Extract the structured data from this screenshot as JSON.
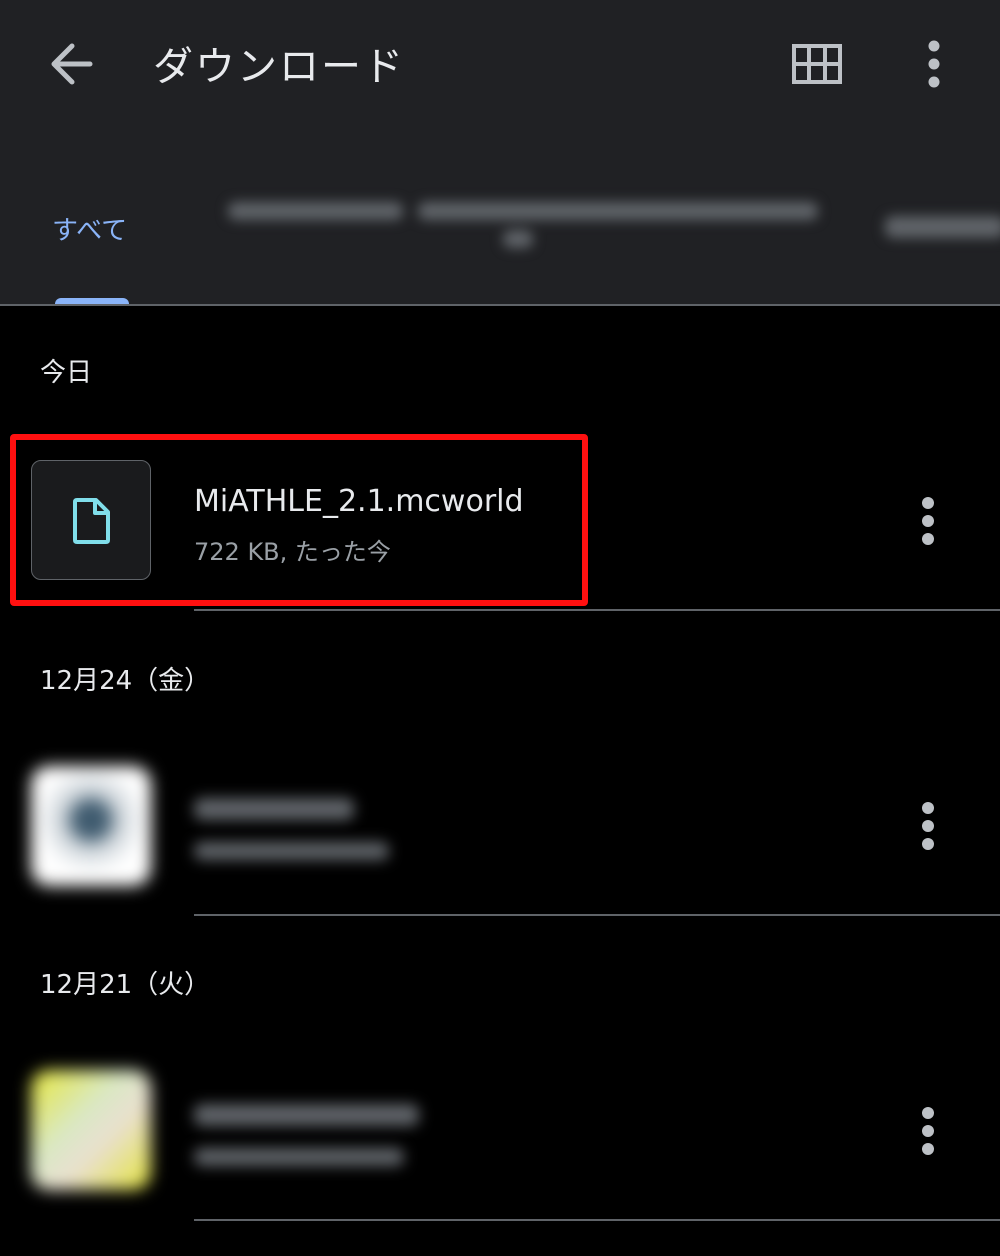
{
  "header": {
    "title": "ダウンロード",
    "back_icon": "arrow-back-icon",
    "grid_icon": "grid-view-icon",
    "more_icon": "more-vert-icon"
  },
  "tabs": {
    "active_label": "すべて",
    "accent_color": "#8ab4f8"
  },
  "sections": [
    {
      "label": "今日"
    },
    {
      "label": "12月24（金）"
    },
    {
      "label": "12月21（火）"
    }
  ],
  "items": [
    {
      "name": "MiATHLE_2.1.mcworld",
      "meta": "722 KB, たった今",
      "icon": "file-icon",
      "highlighted": true
    },
    {
      "name": "",
      "meta": "",
      "icon": "blurred-thumbnail"
    },
    {
      "name": "",
      "meta": "",
      "icon": "blurred-thumbnail"
    }
  ],
  "colors": {
    "highlight_border": "#ff1010",
    "header_bg": "#202124",
    "file_icon": "#80deea"
  }
}
